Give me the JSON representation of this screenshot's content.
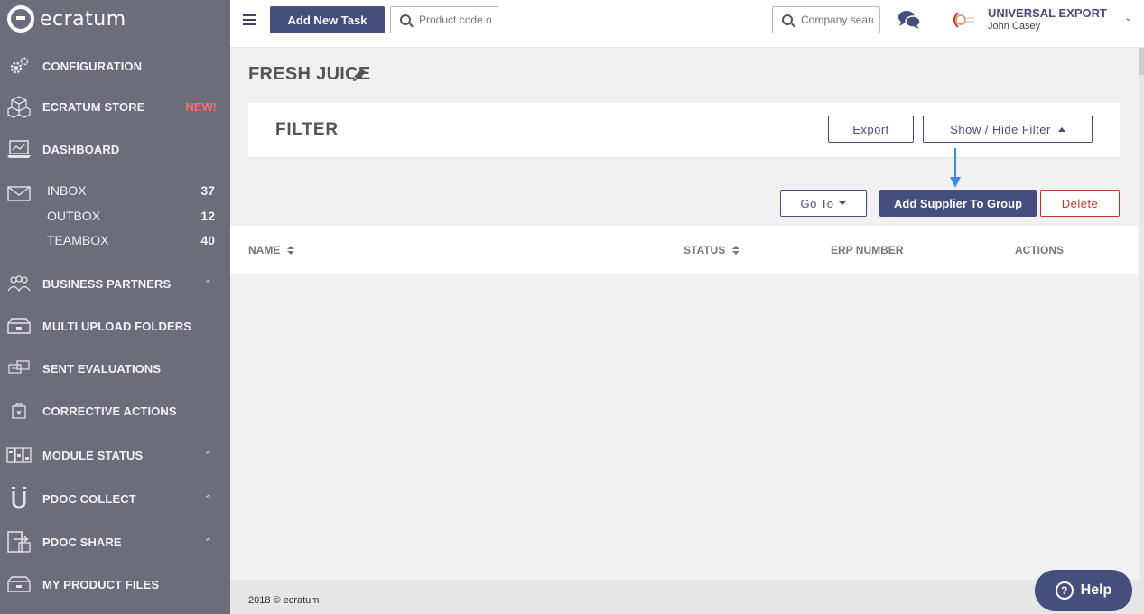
{
  "brand": {
    "logo_text": "ecratum"
  },
  "sidebar": {
    "items": [
      {
        "label": "CONFIGURATION",
        "icon": "gears-icon"
      },
      {
        "label": "ECRATUM STORE",
        "icon": "cubes-icon",
        "badge": "NEW!"
      },
      {
        "label": "DASHBOARD",
        "icon": "laptop-chart-icon"
      },
      {
        "label": "BUSINESS PARTNERS",
        "icon": "people-icon"
      },
      {
        "label": "MULTI UPLOAD FOLDERS",
        "icon": "folder-upload-icon"
      },
      {
        "label": "SENT EVALUATIONS",
        "icon": "evaluation-icon"
      },
      {
        "label": "CORRECTIVE ACTIONS",
        "icon": "corrective-box-icon"
      },
      {
        "label": "MODULE STATUS",
        "icon": "module-grid-icon"
      },
      {
        "label": "PDOC COLLECT",
        "icon": "magnet-icon"
      },
      {
        "label": "PDOC SHARE",
        "icon": "share-icon"
      },
      {
        "label": "MY PRODUCT FILES",
        "icon": "product-files-icon"
      }
    ],
    "mail": [
      {
        "label": "INBOX",
        "count": "37"
      },
      {
        "label": "OUTBOX",
        "count": "12"
      },
      {
        "label": "TEAMBOX",
        "count": "40"
      }
    ]
  },
  "topbar": {
    "add_task_label": "Add New Task",
    "product_search_placeholder": "Product code or",
    "company_search_placeholder": "Company search",
    "company_name": "UNIVERSAL EXPORT",
    "user_name": "John Casey"
  },
  "main": {
    "page_title": "FRESH JUICE",
    "filter_title": "FILTER",
    "export_label": "Export",
    "show_hide_label": "Show / Hide Filter",
    "goto_label": "Go To",
    "add_supplier_label": "Add Supplier To Group",
    "delete_label": "Delete",
    "columns": [
      "NAME",
      "STATUS",
      "ERP NUMBER",
      "ACTIONS"
    ]
  },
  "footer": {
    "text": "2018 © ecratum"
  },
  "help": {
    "label": "Help"
  },
  "colors": {
    "sidebar": "#6b6d7a",
    "primary": "#464e7e",
    "danger": "#c0392b",
    "new_badge": "#ff6d6d",
    "annotation_arrow": "#3b8be8"
  }
}
